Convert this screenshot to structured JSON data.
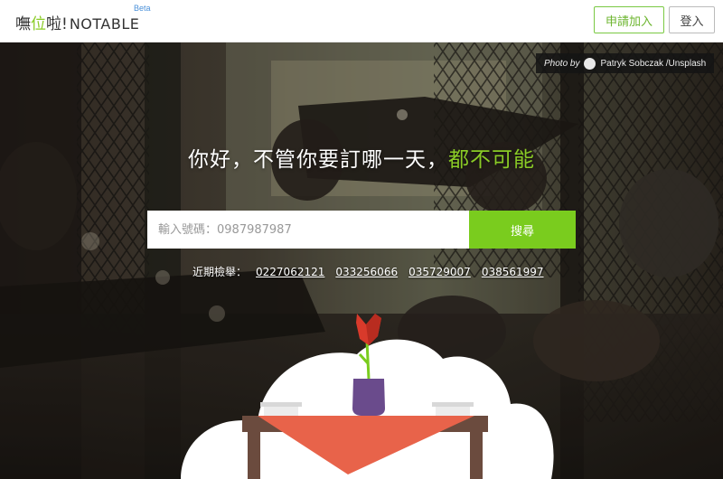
{
  "header": {
    "logo_prefix": "嘸",
    "logo_accent": "位",
    "logo_suffix": "啦!",
    "logo_en": "NOTABLE",
    "beta": "Beta",
    "signup_label": "申請加入",
    "login_label": "登入"
  },
  "hero": {
    "credit_by": "Photo by",
    "credit_name": "Patryk Sobczak /Unsplash",
    "headline_main": "你好，不管你要訂哪一天，",
    "headline_green": "都不可能",
    "search_placeholder": "輸入號碼：0987987987",
    "search_button": "搜尋",
    "recent_label": "近期檢舉：",
    "recent_numbers": [
      "0227062121",
      "033256066",
      "035729007",
      "038561997"
    ]
  },
  "colors": {
    "accent_green": "#7acc1e",
    "beta_blue": "#4a90d9",
    "table_top": "#e8634a",
    "table_wood": "#6b4b3e",
    "vase": "#6a4b8c",
    "flower": "#d93a2b"
  }
}
